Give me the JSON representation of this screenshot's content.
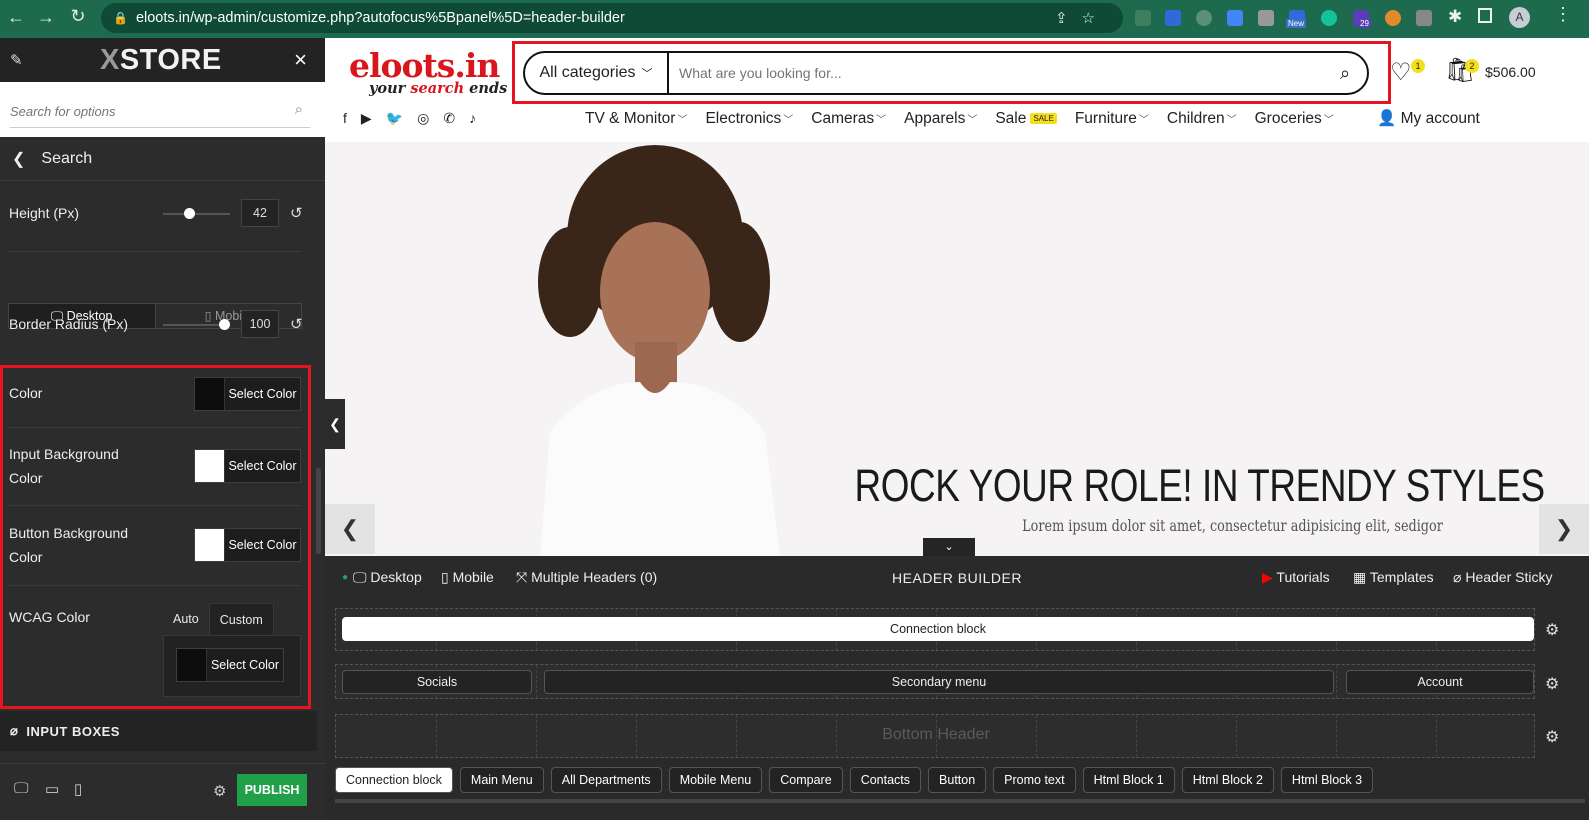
{
  "browser": {
    "url": "eloots.in/wp-admin/customize.php?autofocus%5Bpanel%5D=header-builder",
    "ext_new_badge": "New",
    "ext_count_badge": "29",
    "profile_initial": "A"
  },
  "customizer": {
    "logo_prefix": "X",
    "logo": "STORE",
    "close": "×",
    "search_placeholder": "Search for options",
    "section_title": "Search",
    "height_label": "Height (Px)",
    "height_value": "42",
    "height_fraction": 0.38,
    "device_tabs": [
      "Desktop",
      "Mobile"
    ],
    "border_radius_label": "Border Radius (Px)",
    "border_radius_value": "100",
    "border_radius_fraction": 1.0,
    "color_label": "Color",
    "input_bg_label_1": "Input Background",
    "input_bg_label_2": "Color",
    "button_bg_label_1": "Button Background",
    "button_bg_label_2": "Color",
    "select_color": "Select Color",
    "wcag_label": "WCAG Color",
    "wcag_tabs": [
      "Auto",
      "Custom"
    ],
    "input_boxes": "INPUT BOXES",
    "publish": "PUBLISH",
    "swatches": {
      "color": "#0d0d0d",
      "input_bg": "#ffffff",
      "button_bg": "#ffffff",
      "wcag": "#0d0d0d"
    }
  },
  "site": {
    "logo_text": "eloots.in",
    "logo_tag_1": "your ",
    "logo_tag_2": "search",
    "logo_tag_3": " ends",
    "category": "All categories",
    "search_placeholder": "What are you looking for...",
    "wishlist_count": "1",
    "cart_count": "2",
    "cart_total": "$506.00",
    "nav": [
      "TV & Monitor",
      "Electronics",
      "Cameras",
      "Apparels",
      "Sale",
      "Furniture",
      "Children",
      "Groceries"
    ],
    "sale_badge": "SALE",
    "account": "My account",
    "hero_title": "ROCK YOUR ROLE! IN TRENDY STYLES",
    "hero_sub": "Lorem ipsum dolor sit amet, consectetur adipisicing elit, sedigor"
  },
  "builder": {
    "desktop": "Desktop",
    "mobile": "Mobile",
    "multiple_headers": "Multiple Headers (0)",
    "title": "HEADER BUILDER",
    "tutorials": "Tutorials",
    "templates": "Templates",
    "header_sticky": "Header Sticky",
    "row1_block": "Connection block",
    "row2_blocks": [
      "Socials",
      "Secondary menu",
      "Account"
    ],
    "row3_label": "Bottom Header",
    "available": [
      "Connection block",
      "Main Menu",
      "All Departments",
      "Mobile Menu",
      "Compare",
      "Contacts",
      "Button",
      "Promo text",
      "Html Block 1",
      "Html Block 2",
      "Html Block 3"
    ]
  }
}
